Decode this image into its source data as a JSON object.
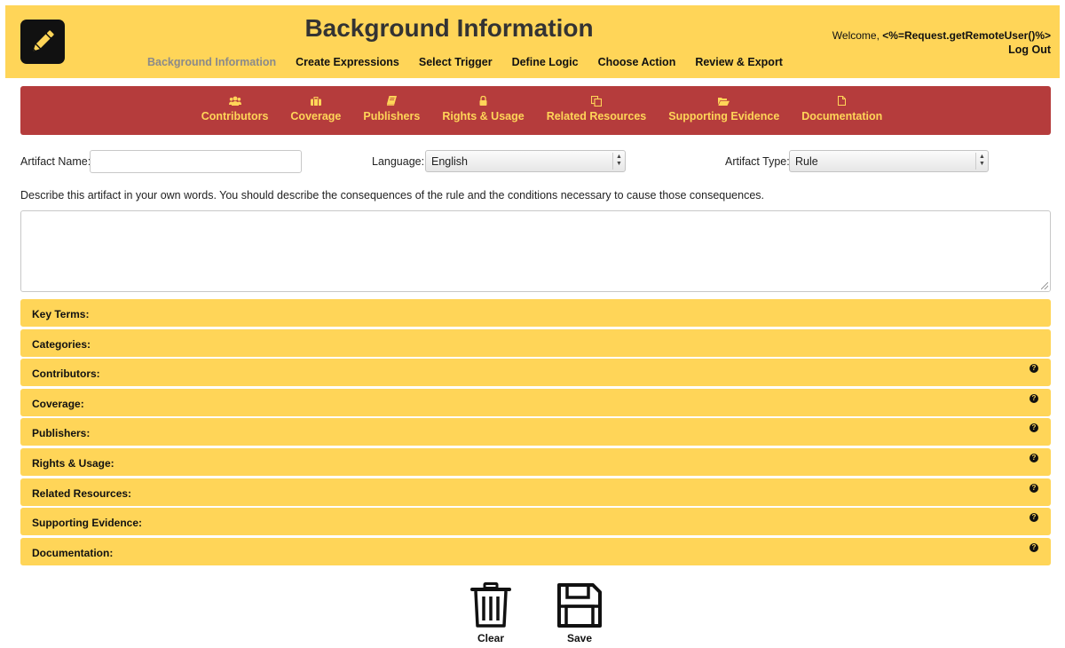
{
  "header": {
    "title": "Background Information",
    "logo_icon": "pencil-icon",
    "welcome_prefix": "Welcome, ",
    "welcome_user": "<%=Request.getRemoteUser()%>",
    "logout_label": "Log Out",
    "nav": [
      {
        "label": "Background Information",
        "active": true
      },
      {
        "label": "Create Expressions"
      },
      {
        "label": "Select Trigger"
      },
      {
        "label": "Define Logic"
      },
      {
        "label": "Choose Action"
      },
      {
        "label": "Review & Export"
      }
    ]
  },
  "subnav": [
    {
      "label": "Contributors",
      "icon": "users-icon"
    },
    {
      "label": "Coverage",
      "icon": "briefcase-icon"
    },
    {
      "label": "Publishers",
      "icon": "book-icon"
    },
    {
      "label": "Rights & Usage",
      "icon": "lock-icon"
    },
    {
      "label": "Related Resources",
      "icon": "copy-icon"
    },
    {
      "label": "Supporting Evidence",
      "icon": "folder-open-icon"
    },
    {
      "label": "Documentation",
      "icon": "file-icon"
    }
  ],
  "form": {
    "artifact_name_label": "Artifact Name:",
    "artifact_name_value": "",
    "language_label": "Language:",
    "language_value": "English",
    "artifact_type_label": "Artifact Type:",
    "artifact_type_value": "Rule",
    "description_prompt": "Describe this artifact in your own words. You should describe the consequences of the rule and the conditions necessary to cause those consequences.",
    "description_value": ""
  },
  "sections": [
    {
      "label": "Key Terms:",
      "help": false
    },
    {
      "label": "Categories:",
      "help": false
    },
    {
      "label": "Contributors:",
      "help": true
    },
    {
      "label": "Coverage:",
      "help": true
    },
    {
      "label": "Publishers:",
      "help": true
    },
    {
      "label": "Rights & Usage:",
      "help": true
    },
    {
      "label": "Related Resources:",
      "help": true
    },
    {
      "label": "Supporting Evidence:",
      "help": true
    },
    {
      "label": "Documentation:",
      "help": true
    }
  ],
  "help_glyph": "?",
  "actions": {
    "clear_label": "Clear",
    "clear_icon": "trash-icon",
    "save_label": "Save",
    "save_icon": "floppy-disk-icon"
  },
  "colors": {
    "header_bg": "#ffd558",
    "subnav_bg": "#b53c3c",
    "subnav_text": "#ffd558"
  }
}
